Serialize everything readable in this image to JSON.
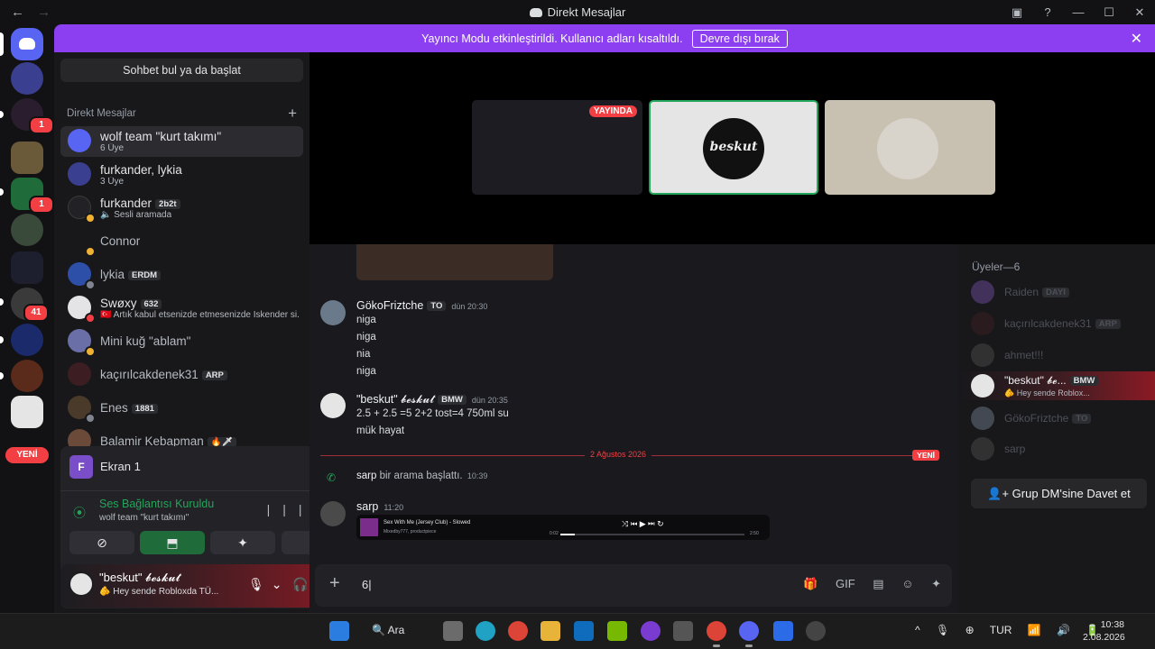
{
  "window": {
    "title": "Direkt Mesajlar",
    "nav": {
      "back": "←",
      "forward": "→"
    },
    "controls": {
      "inbox": "▣",
      "help": "?",
      "minimize": "—",
      "maximize": "☐",
      "close": "✕"
    }
  },
  "banner": {
    "text": "Yayıncı Modu etkinleştirildi. Kullanıcı adları kısaltıldı.",
    "button": "Devre dışı bırak",
    "close": "✕"
  },
  "servers": {
    "badges": [
      "1",
      "1",
      "41"
    ],
    "new_label": "YENİ"
  },
  "dm_panel": {
    "search_label": "Sohbet bul ya da başlat",
    "header": "Direkt Mesajlar",
    "add": "+",
    "items": [
      {
        "name": "wolf team \"kurt takımı\"",
        "sub": "6 Üye",
        "tag": "",
        "color": "#5865f2"
      },
      {
        "name": "furkander, lykia",
        "sub": "3 Üye",
        "tag": "",
        "color": "#3b3f8f"
      },
      {
        "name": "furkander",
        "sub": "🔈 Sesli aramada",
        "tag": "2b2t",
        "color": "#222226"
      },
      {
        "name": "Connor",
        "sub": "",
        "tag": "",
        "color": "#18181b"
      },
      {
        "name": "lykia",
        "sub": "",
        "tag": "ERDM",
        "color": "#2d4fa8"
      },
      {
        "name": "Swøxy",
        "sub": "🇹🇷 Artık kabul etsenizde etmesenizde İskender si...",
        "tag": "632",
        "color": "#e4e4e7"
      },
      {
        "name": "Mini kuğ \"ablam\"",
        "sub": "",
        "tag": "",
        "color": "#6b6fa8"
      },
      {
        "name": "kaçırılcakdenek31",
        "sub": "",
        "tag": "ARP",
        "color": "#3b1d22"
      },
      {
        "name": "Enes",
        "sub": "",
        "tag": "1881",
        "color": "#4a3a2a"
      },
      {
        "name": "Balamir Kebapman",
        "sub": "",
        "tag": "🔥🗡",
        "color": "#6b4a3a"
      }
    ]
  },
  "voice": {
    "screen_initial": "F",
    "screen_label": "Ekran 1",
    "status_title": "Ses Bağlantısı Kuruldu",
    "status_sub": "wolf team \"kurt takımı\"",
    "icons": {
      "waveform": "|||",
      "hangup": "☎"
    },
    "buttons": [
      "⊘",
      "⬒",
      "✦",
      "⚡"
    ]
  },
  "user": {
    "name": "\"beskut\" 𝓫𝓮𝓼𝓴𝓾𝓽",
    "status": "🫵 Hey sende Robloxda TÜ..."
  },
  "stream": {
    "live_label": "YAYINDA",
    "tile2_text": "beskut"
  },
  "messages": [
    {
      "author": "GökoFriztche",
      "tag": "TO",
      "time": "dün 20:30",
      "lines": [
        "niga",
        "niga",
        "nia",
        "niga"
      ]
    },
    {
      "author": "\"beskut\" 𝓫𝓮𝓼𝓴𝓾𝓽",
      "tag": "BMW",
      "time": "dün 20:35",
      "lines": [
        "2.5 + 2.5 =5 2+2 tost=4 750ml su",
        "mük hayat"
      ]
    }
  ],
  "divider": {
    "date": "2 Ağustos 2026",
    "new": "YENİ"
  },
  "call_event": {
    "author": "sarp",
    "text": "bir arama başlattı.",
    "time": "10:39"
  },
  "last_message": {
    "author": "sarp",
    "time": "11:20",
    "spotify": {
      "title": "Sex With Me (Jersey Club) - Slowed",
      "artist": "Mixedby777, productpiece",
      "controls": "⤨ ⏮ ▶ ⏭ ↻",
      "time_start": "0:02",
      "time_end": "2:50",
      "progress": 0.08
    }
  },
  "composer": {
    "value": "6",
    "plus": "+",
    "tools": [
      "🎁",
      "GIF",
      "▤",
      "☺",
      "✦"
    ]
  },
  "members": {
    "header": "Üyeler—6",
    "list": [
      {
        "name": "Raiden",
        "tag": "DAYI",
        "sub": "",
        "color": "#6b4a9b"
      },
      {
        "name": "kaçırılcakdenek31",
        "tag": "ARP",
        "sub": "",
        "color": "#3b1d22"
      },
      {
        "name": "ahmet!!!",
        "tag": "",
        "sub": "",
        "color": "#4a4a4a"
      },
      {
        "name": "\"beskut\" 𝓫𝓮...",
        "tag": "BMW",
        "sub": "🫵 Hey sende Roblox...",
        "color": "#e5e5e5"
      },
      {
        "name": "GökoFriztche",
        "tag": "TO",
        "sub": "",
        "color": "#6b7a8a"
      },
      {
        "name": "sarp",
        "tag": "",
        "sub": "",
        "color": "#4a4a4a"
      }
    ],
    "invite": "Grup DM'sine Davet et"
  },
  "taskbar": {
    "search": "Ara",
    "tray": [
      "^",
      "🎙",
      "⊕",
      "TUR",
      "📶",
      "🔊",
      "🔋"
    ],
    "time": "10:38",
    "date": "2.08.2026"
  }
}
